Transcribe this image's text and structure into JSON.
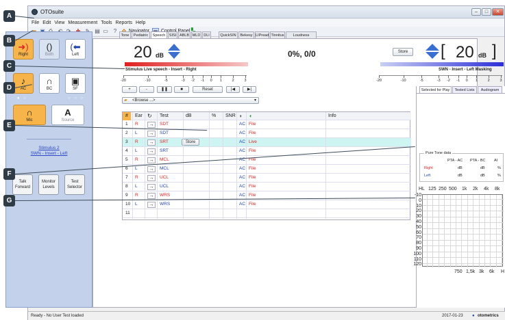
{
  "window": {
    "title": "OTOsuite",
    "controls": [
      "–",
      "□",
      "✕"
    ]
  },
  "menus": [
    "File",
    "Edit",
    "View",
    "Measurement",
    "Tools",
    "Reports",
    "Help"
  ],
  "toolbar": {
    "navigator": "Navigator",
    "control_panel": "Control Panel"
  },
  "callouts": [
    "A",
    "B",
    "C",
    "D",
    "E",
    "F",
    "G"
  ],
  "sidebar": {
    "ear_buttons": [
      {
        "label": "Right",
        "icon": "right-ear-icon",
        "glyph": "➜)"
      },
      {
        "label": "Both",
        "icon": "both-ears-icon",
        "glyph": "()"
      },
      {
        "label": "Left",
        "icon": "left-ear-icon",
        "glyph": "(⬅"
      }
    ],
    "transducers": [
      {
        "label": "AC",
        "icon": "insert-phone-icon",
        "glyph": "♪"
      },
      {
        "label": "BC",
        "icon": "bone-conductor-icon",
        "glyph": "∩"
      },
      {
        "label": "SF",
        "icon": "speaker-icon",
        "glyph": "▣"
      }
    ],
    "sources": [
      {
        "label": "Mic",
        "icon": "microphone-icon",
        "glyph": "∩"
      },
      {
        "label": "Source",
        "icon": "source-icon",
        "glyph": "A"
      }
    ],
    "dots": "● ○",
    "dots2": "○ ○ ○",
    "stimulus_line1": "Stimulus 2",
    "stimulus_line2": "SWN - Insert - Left",
    "bottom_buttons": [
      {
        "l1": "Talk",
        "l2": "Forward"
      },
      {
        "l1": "Monitor",
        "l2": "Levels"
      },
      {
        "l1": "Test",
        "l2": "Selector"
      }
    ]
  },
  "tabs": [
    "Tone",
    "Pediatric",
    "Speech",
    "SISI",
    "ABLB",
    "MLD",
    "DLI",
    "QuickSIN",
    "Bekesy",
    "LIPread",
    "Tinnitus",
    "Loudness Scaling"
  ],
  "active_tab": "Speech",
  "left_level": {
    "value": "20",
    "unit": "dB"
  },
  "score": "0%, 0/0",
  "store_top": "Store",
  "right_level": {
    "value": "20",
    "unit": "dB"
  },
  "bracket_l": "[",
  "bracket_r": "]",
  "stimulus_label": "Stimulus  Live speech - Insert - Right",
  "masking_label": "SWN - Insert - Left  Masking",
  "left_ruler": [
    "-20",
    "-10",
    "-5",
    "-3",
    "-2",
    "-1",
    "0",
    "1",
    "2",
    "3"
  ],
  "right_ruler": [
    "-20",
    "-10",
    "-5",
    "-3",
    "-2",
    "-1",
    "0",
    "1",
    "2",
    "3"
  ],
  "controls": {
    "plus": "+",
    "minus": "-",
    "pause": "❚❚",
    "stop": "■",
    "reset": "Reset",
    "prev": "|◀",
    "next": "▶|",
    "browse": "<Browse ...>"
  },
  "table": {
    "headers": [
      "#",
      "Ear",
      "",
      "Test",
      "dB",
      "%",
      "SNR",
      "",
      "",
      "Info"
    ],
    "rows": [
      {
        "n": "1",
        "ear": "R",
        "test": "SDT",
        "snr": "AC",
        "info": "File",
        "ec": "r",
        "store": ""
      },
      {
        "n": "2",
        "ear": "L",
        "test": "SDT",
        "snr": "AC",
        "info": "File",
        "ec": "b",
        "store": ""
      },
      {
        "n": "3",
        "ear": "R",
        "test": "SRT",
        "snr": "AC",
        "info": "Live",
        "ec": "r",
        "store": "Store"
      },
      {
        "n": "4",
        "ear": "L",
        "test": "SRT",
        "snr": "AC",
        "info": "File",
        "ec": "b",
        "store": ""
      },
      {
        "n": "5",
        "ear": "R",
        "test": "MCL",
        "snr": "AC",
        "info": "File",
        "ec": "r",
        "store": ""
      },
      {
        "n": "6",
        "ear": "L",
        "test": "MCL",
        "snr": "AC",
        "info": "File",
        "ec": "b",
        "store": ""
      },
      {
        "n": "7",
        "ear": "R",
        "test": "UCL",
        "snr": "AC",
        "info": "File",
        "ec": "r",
        "store": ""
      },
      {
        "n": "8",
        "ear": "L",
        "test": "UCL",
        "snr": "AC",
        "info": "File",
        "ec": "b",
        "store": ""
      },
      {
        "n": "9",
        "ear": "R",
        "test": "WRS",
        "snr": "AC",
        "info": "File",
        "ec": "r",
        "store": ""
      },
      {
        "n": "10",
        "ear": "L",
        "test": "WRS",
        "snr": "AC",
        "info": "File",
        "ec": "b",
        "store": ""
      },
      {
        "n": "11",
        "ear": "",
        "test": "",
        "snr": "",
        "info": "",
        "ec": "b",
        "store": ""
      }
    ]
  },
  "right_tabs": [
    "Selected for Play",
    "Tested Lists",
    "Audiogram"
  ],
  "pure_tone": {
    "title": "Pure Tone data",
    "h1": "PTA - AC",
    "h2": "PTA - BC",
    "h3": "AI",
    "rows": [
      {
        "ear": "Right",
        "u1": "dB",
        "u2": "dB",
        "u3": "%"
      },
      {
        "ear": "Left",
        "u1": "dB",
        "u2": "dB",
        "u3": "%"
      }
    ]
  },
  "audiogram": {
    "hl": "HL",
    "freqs_top": [
      "125",
      "250",
      "500",
      "1k",
      "2k",
      "4k",
      "8k"
    ],
    "levels": [
      "-10",
      "0",
      "10",
      "20",
      "30",
      "40",
      "50",
      "60",
      "70",
      "80",
      "90",
      "100",
      "110",
      "120"
    ],
    "freqs_bottom": [
      "750",
      "1,5k",
      "3k",
      "6k",
      "H"
    ]
  },
  "status": {
    "left": "Ready - No User Test loaded",
    "date": "2017-01-23",
    "brand": "otometrics"
  },
  "colors": {
    "right_ear": "#dd2222",
    "left_ear": "#1f3fa8",
    "selected": "#f6b44a",
    "sidebar": "#c3d1ea"
  }
}
